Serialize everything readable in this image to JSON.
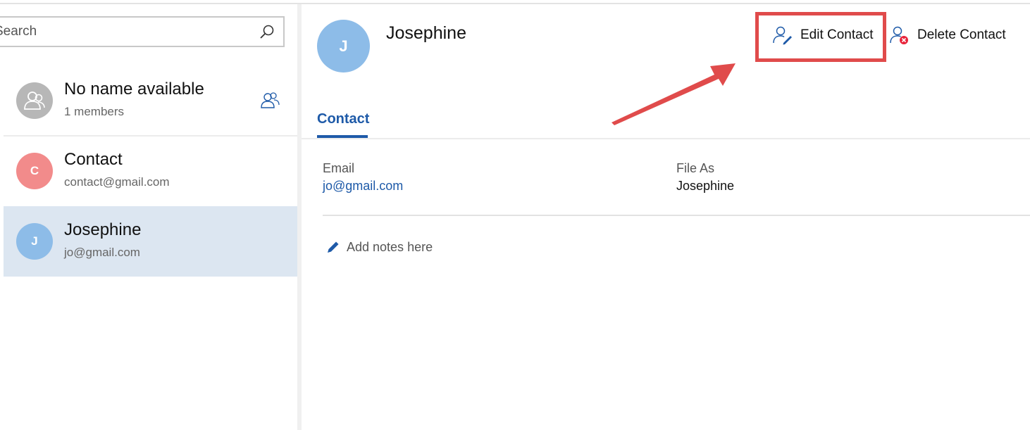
{
  "search": {
    "placeholder": "Search"
  },
  "contacts": [
    {
      "name": "No name available",
      "sub": "1 members",
      "initial": "",
      "color": "#b7b7b7",
      "icon": "group-avatar-icon"
    },
    {
      "name": "Contact",
      "sub": "contact@gmail.com",
      "initial": "C",
      "color": "#f28b8b"
    },
    {
      "name": "Josephine",
      "sub": "jo@gmail.com",
      "initial": "J",
      "color": "#8dbce8",
      "selected": true
    }
  ],
  "detail": {
    "initial": "J",
    "name": "Josephine",
    "edit_label": "Edit Contact",
    "delete_label": "Delete Contact",
    "tab_label": "Contact",
    "email_label": "Email",
    "email_value": "jo@gmail.com",
    "file_as_label": "File As",
    "file_as_value": "Josephine",
    "notes_label": "Add notes here"
  },
  "colors": {
    "accent": "#1e5aa8",
    "highlight": "#e04b4b",
    "selected_bg": "#dce6f1"
  }
}
